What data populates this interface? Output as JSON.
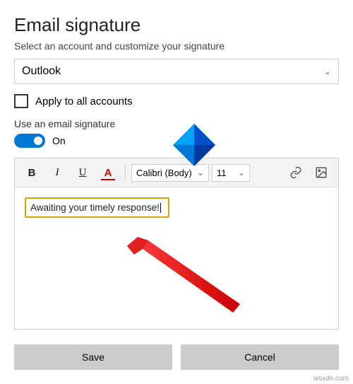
{
  "title": "Email signature",
  "subtitle": "Select an account and customize your signature",
  "account_select": {
    "value": "Outlook"
  },
  "apply_all": {
    "label": "Apply to all accounts",
    "checked": false
  },
  "use_signature": {
    "label": "Use an email signature",
    "toggle_label": "On",
    "enabled": true
  },
  "toolbar": {
    "bold": "B",
    "italic": "I",
    "underline": "U",
    "color": "A",
    "font": "Calibri (Body)",
    "size": "11",
    "link_icon": "link-icon",
    "image_icon": "image-icon"
  },
  "editor": {
    "text": "Awaiting your timely response!"
  },
  "buttons": {
    "save": "Save",
    "cancel": "Cancel"
  },
  "watermark": "wsxdn.com"
}
